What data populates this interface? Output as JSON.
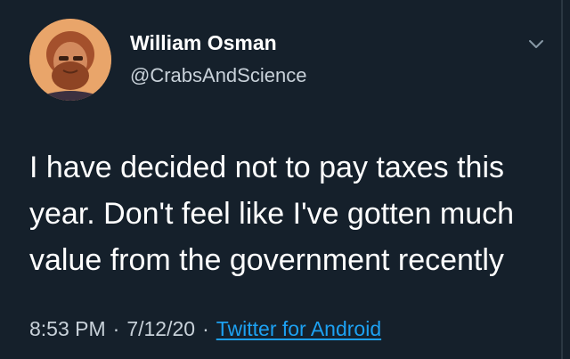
{
  "tweet": {
    "author": {
      "display_name": "William Osman",
      "handle": "@CrabsAndScience",
      "avatar_icon": "profile-photo"
    },
    "menu_icon": "chevron-down-icon",
    "text_lines": [
      "I have decided not to pay taxes this",
      "year. Don't feel like I've gotten much",
      "value from the government recently"
    ],
    "time": "8:53 PM",
    "date": "7/12/20",
    "separator": "·",
    "source": "Twitter for Android"
  },
  "colors": {
    "background": "#15202b",
    "text": "#ffffff",
    "secondary_text": "#c8d1d9",
    "link": "#1da1f2"
  }
}
